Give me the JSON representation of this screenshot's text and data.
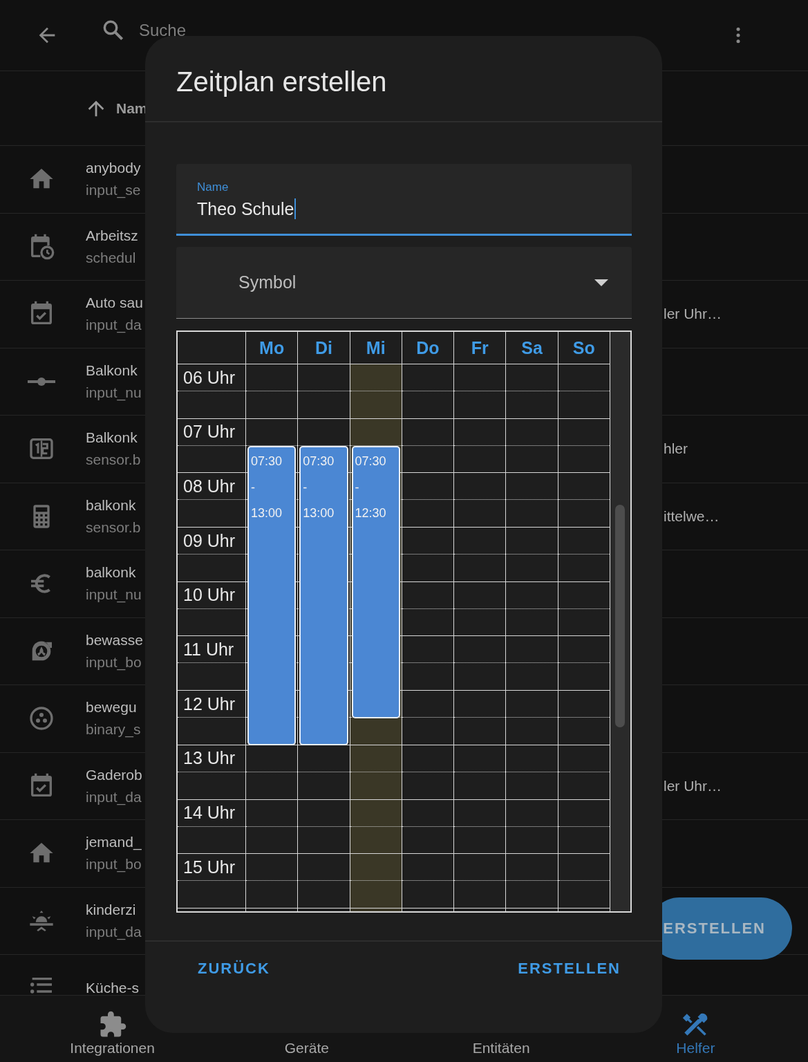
{
  "top_bar": {
    "search": {
      "placeholder": "Suche"
    }
  },
  "list_header": {
    "sort_label": "Nam"
  },
  "rows": [
    {
      "name": "anybody",
      "entity_id": "input_se"
    },
    {
      "name": "Arbeitsz",
      "entity_id": "schedul"
    },
    {
      "name": "Auto sau",
      "entity_id": "input_da",
      "column_3": "ler Uhr…"
    },
    {
      "name": "Balkonk",
      "entity_id": "input_nu"
    },
    {
      "name": "Balkonk",
      "entity_id": "sensor.b",
      "column_3": "hler"
    },
    {
      "name": "balkonk",
      "entity_id": "sensor.b",
      "column_3": "ittelwe…"
    },
    {
      "name": "balkonk",
      "entity_id": "input_nu"
    },
    {
      "name": "bewasse",
      "entity_id": "input_bo"
    },
    {
      "name": "bewegu",
      "entity_id": "binary_s"
    },
    {
      "name": "Gaderob",
      "entity_id": "input_da",
      "column_3": "ler Uhr…"
    },
    {
      "name": "jemand_",
      "entity_id": "input_bo"
    },
    {
      "name": "kinderzi",
      "entity_id": "input_da"
    },
    {
      "name": "Küche-s"
    }
  ],
  "fab": {
    "label": "ERSTELLEN"
  },
  "bottom_nav": [
    {
      "label": "Integrationen",
      "selected": false
    },
    {
      "label": "Geräte",
      "selected": false
    },
    {
      "label": "Entitäten",
      "selected": false
    },
    {
      "label": "Helfer",
      "selected": true
    }
  ],
  "dialog": {
    "title": "Zeitplan erstellen",
    "name_field": {
      "label": "Name",
      "value": "Theo Schule",
      "focused": true
    },
    "icon_field": {
      "placeholder": "Symbol"
    },
    "schedule": {
      "hours": [
        "06 Uhr",
        "07 Uhr",
        "08 Uhr",
        "09 Uhr",
        "10 Uhr",
        "11 Uhr",
        "12 Uhr",
        "13 Uhr",
        "14 Uhr",
        "15 Uhr"
      ],
      "days": [
        {
          "label": "Mo",
          "today": false,
          "blocks": [
            {
              "start": "07:30",
              "separator": "-",
              "end": "13:00"
            }
          ]
        },
        {
          "label": "Di",
          "today": false,
          "blocks": [
            {
              "start": "07:30",
              "separator": "-",
              "end": "13:00"
            }
          ]
        },
        {
          "label": "Mi",
          "today": true,
          "blocks": [
            {
              "start": "07:30",
              "separator": "-",
              "end": "12:30"
            }
          ]
        },
        {
          "label": "Do",
          "today": false
        },
        {
          "label": "Fr",
          "today": false
        },
        {
          "label": "Sa",
          "today": false
        },
        {
          "label": "So",
          "today": false
        }
      ]
    },
    "buttons": [
      {
        "label": "ZURÜCK"
      },
      {
        "label": "ERSTELLEN"
      }
    ]
  }
}
